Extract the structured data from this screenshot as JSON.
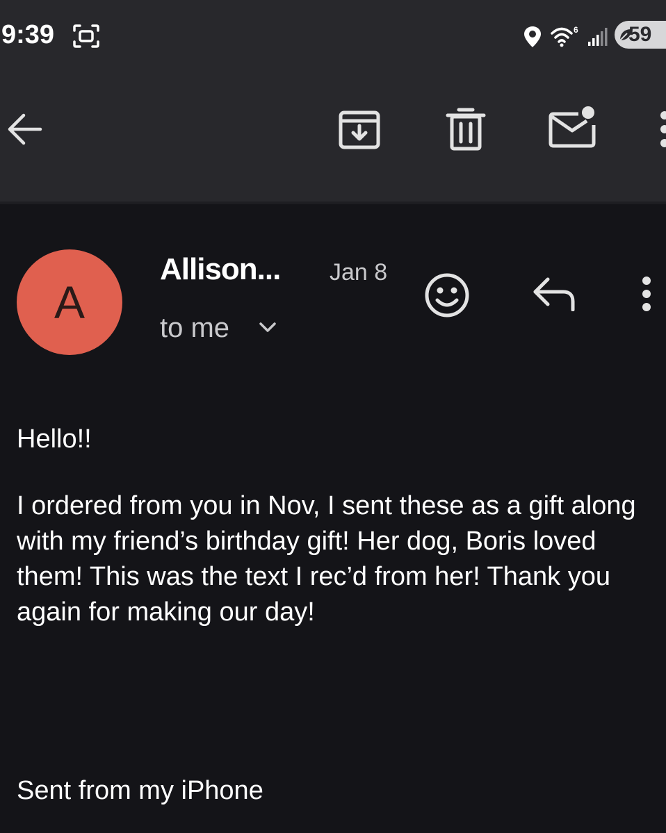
{
  "status_bar": {
    "time": "9:39",
    "battery": "59",
    "icons": [
      "screenshot-icon",
      "location-icon",
      "wifi-6-icon",
      "signal-icon",
      "battery-saver-icon"
    ]
  },
  "toolbar": {
    "back_icon": "arrow-left-icon",
    "actions": [
      "archive-icon",
      "delete-icon",
      "mark-unread-icon",
      "more-vert-icon"
    ]
  },
  "email": {
    "avatar_letter": "A",
    "avatar_color": "#e0604f",
    "sender": "Allison...",
    "date": "Jan 8",
    "recipient": "to me",
    "greeting": "Hello!!",
    "paragraph": "I ordered from you in Nov, I sent these as a gift along with my friend’s birthday gift! Her dog, Boris loved them! This was the text I rec’d from her! Thank you again for making our day!",
    "signature": "Sent from my iPhone"
  },
  "colors": {
    "toolbar_bg": "#28282c",
    "page_bg": "#141418",
    "icon_color": "#e3e3e3"
  }
}
